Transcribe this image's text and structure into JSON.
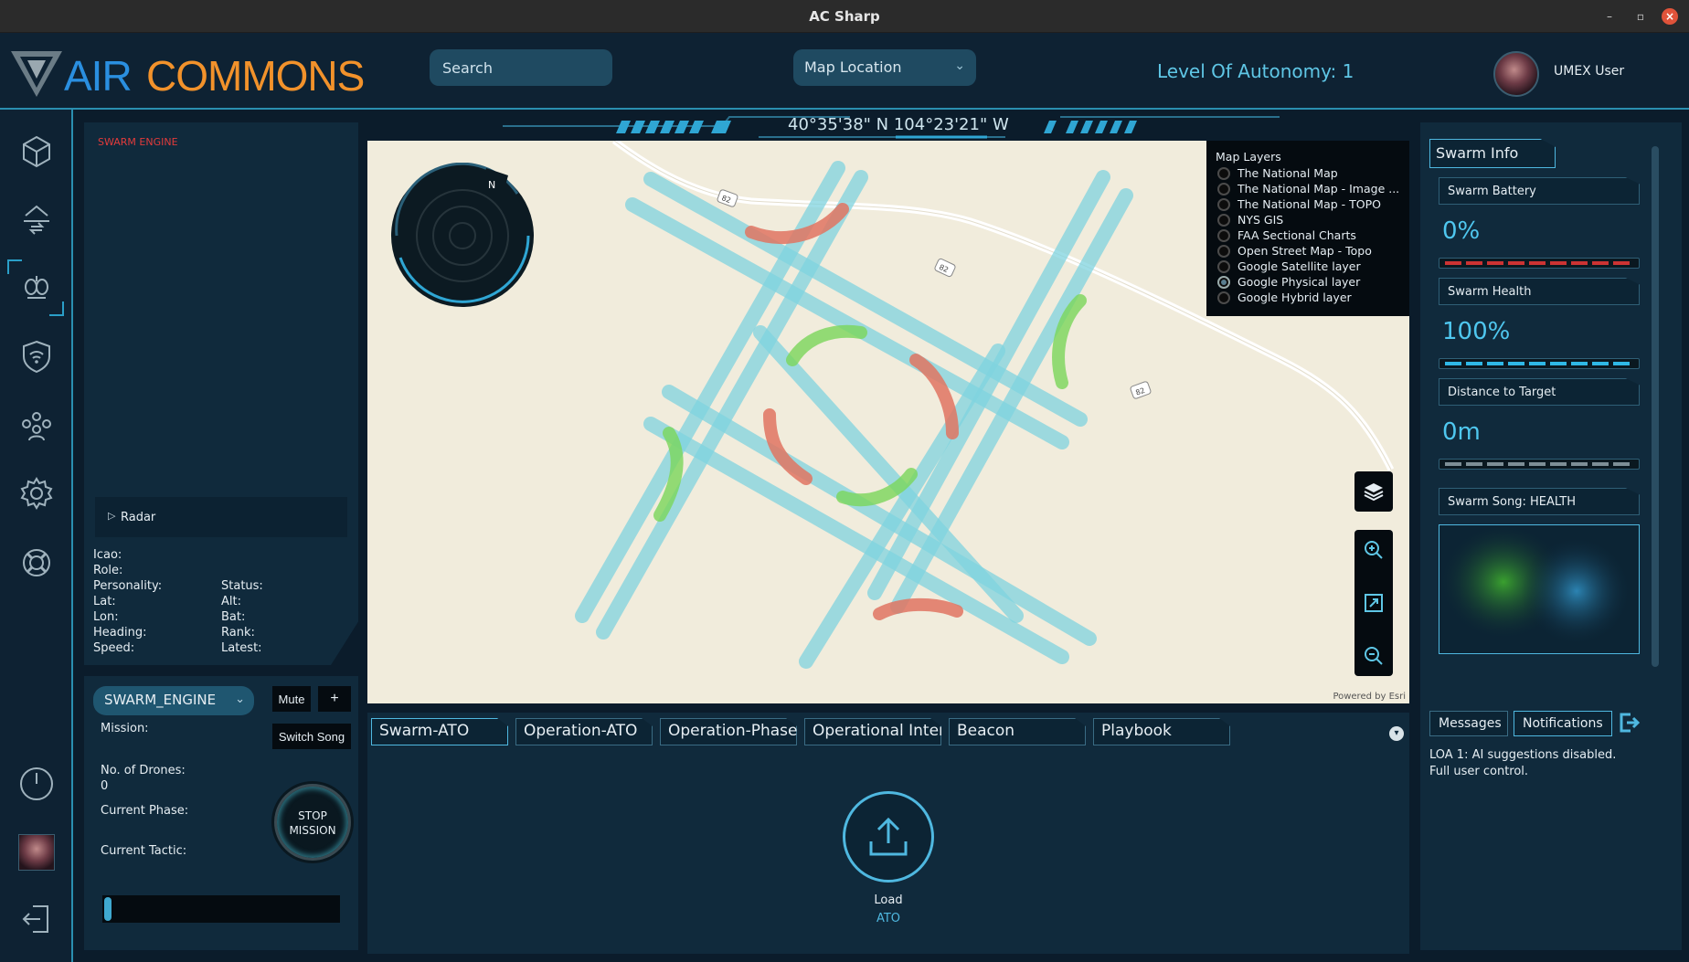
{
  "window": {
    "title": "AC Sharp"
  },
  "header": {
    "logo_air": "AIR",
    "logo_commons": "COMMONS",
    "search_placeholder": "Search",
    "map_location": "Map Location",
    "level_of_autonomy": "Level Of Autonomy: 1",
    "user_name": "UMEX User"
  },
  "nav": {
    "items": [
      "cube-icon",
      "swap-arrows-icon",
      "bee-swarm-icon",
      "shield-wifi-icon",
      "group-icon",
      "gear-icon",
      "lifebuoy-icon",
      "power-icon",
      "avatar",
      "logout-icon"
    ],
    "selected": "bee-swarm-icon"
  },
  "coordinates": "40°35'38\" N  104°23'21\" W",
  "engine": {
    "title": "SWARM ENGINE",
    "radar_label": "Radar",
    "fields": {
      "icao": "Icao:",
      "role": "Role:",
      "personality": "Personality:",
      "status": "Status:",
      "lat": "Lat:",
      "alt": "Alt:",
      "lon": "Lon:",
      "bat": "Bat:",
      "heading": "Heading:",
      "rank": "Rank:",
      "speed": "Speed:",
      "latest": "Latest:"
    }
  },
  "mission": {
    "engine_select": "SWARM_ENGINE",
    "mute": "Mute",
    "add": "+",
    "switch_song": "Switch Song",
    "mission_label": "Mission:",
    "drones_label": "No. of Drones:",
    "drones_value": "0",
    "phase_label": "Current Phase:",
    "tactic_label": "Current Tactic:",
    "stop_line1": "STOP",
    "stop_line2": "MISSION",
    "progress": 0.03
  },
  "map": {
    "compass_label": "N",
    "layers_title": "Map Layers",
    "layers": [
      "The National Map",
      "The National Map - Image ...",
      "The National Map - TOPO",
      "NYS GIS",
      "FAA Sectional Charts",
      "Open Street Map - Topo",
      "Google Satellite layer",
      "Google Physical layer",
      "Google Hybrid layer"
    ],
    "selected_layer": "Google Physical layer",
    "road_shield": "82",
    "powered_by": "Powered by Esri"
  },
  "tabs": {
    "items": [
      "Swarm-ATO",
      "Operation-ATO",
      "Operation-Phase",
      "Operational Intent",
      "Beacon",
      "Playbook"
    ],
    "active": "Swarm-ATO",
    "load_label": "Load",
    "load_sub": "ATO"
  },
  "swarm_info": {
    "title": "Swarm Info",
    "battery_label": "Swarm Battery",
    "battery_value": "0%",
    "health_label": "Swarm Health",
    "health_value": "100%",
    "distance_label": "Distance to Target",
    "distance_value": "0m",
    "song_label": "Swarm Song: HEALTH"
  },
  "messages": {
    "messages_tab": "Messages",
    "notifications_tab": "Notifications",
    "notification_text": "LOA 1: AI suggestions disabled. Full user control."
  },
  "colors": {
    "accent": "#4fb8e0",
    "brand_blue": "#2a8fe0",
    "brand_orange": "#f2922b",
    "alert_red": "#e23b3b"
  }
}
